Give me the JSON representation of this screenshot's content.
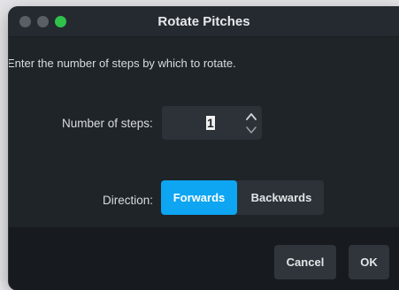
{
  "window": {
    "title": "Rotate Pitches"
  },
  "dialog": {
    "instructions": "Enter the number of steps by which to rotate.",
    "steps_label": "Number of steps:",
    "steps_value": "1",
    "direction_label": "Direction:",
    "direction_options": [
      "Forwards",
      "Backwards"
    ],
    "direction_selected": "Forwards"
  },
  "footer": {
    "cancel_label": "Cancel",
    "ok_label": "OK"
  },
  "icons": {
    "spin_up": "chevron-up-icon",
    "spin_down": "chevron-down-icon"
  },
  "colors": {
    "accent": "#0ea5f2",
    "window_bg": "#1f2429",
    "footer_bg": "#171b1f",
    "close_button": "#5a5f66",
    "zoom_button": "#2ec24a"
  }
}
